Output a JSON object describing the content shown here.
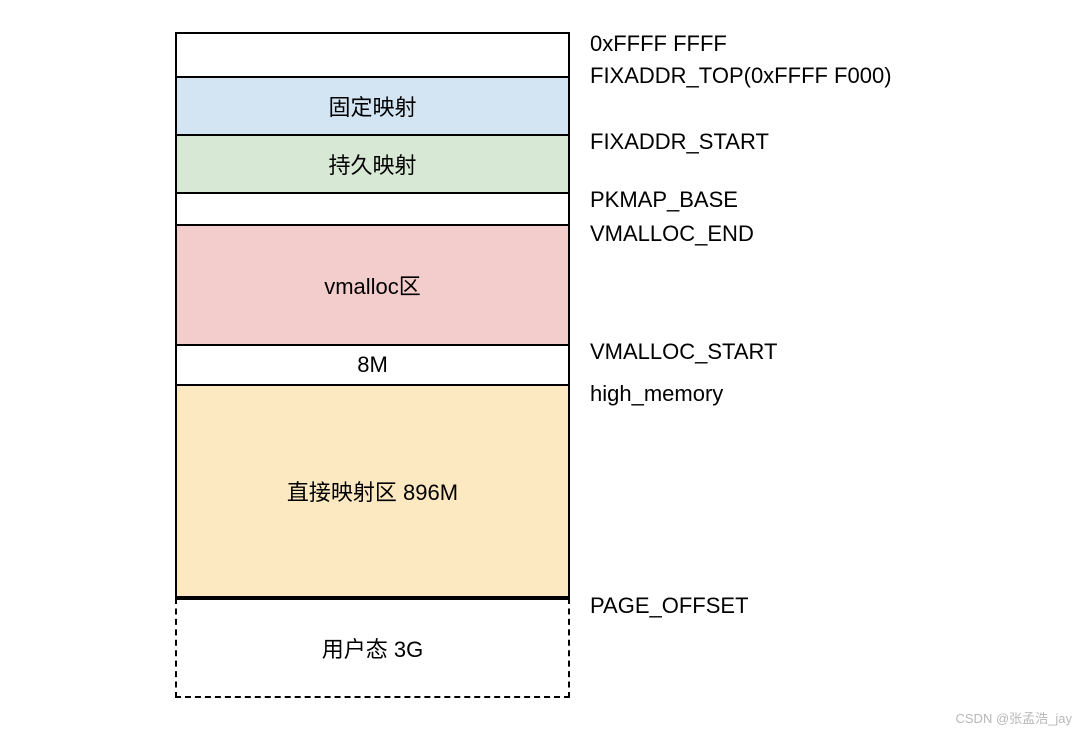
{
  "segments": {
    "top_gap": "",
    "fixed_map": "固定映射",
    "persistent_map": "持久映射",
    "gap2": "",
    "vmalloc": "vmalloc区",
    "eight_m": "8M",
    "direct_map": "直接映射区 896M",
    "user_space": "用户态 3G"
  },
  "labels": {
    "ffff_ffff": "0xFFFF FFFF",
    "fixaddr_top": "FIXADDR_TOP(0xFFFF F000)",
    "fixaddr_start": "FIXADDR_START",
    "pkmap_base": "PKMAP_BASE",
    "vmalloc_end": "VMALLOC_END",
    "vmalloc_start": "VMALLOC_START",
    "high_memory": "high_memory",
    "page_offset": "PAGE_OFFSET"
  },
  "colors": {
    "fixed_map": "#d3e4f2",
    "persistent_map": "#d7e8d4",
    "vmalloc": "#f3cdcc",
    "direct_map": "#fce9c1",
    "white": "#ffffff"
  },
  "watermark": "CSDN @张孟浩_jay"
}
